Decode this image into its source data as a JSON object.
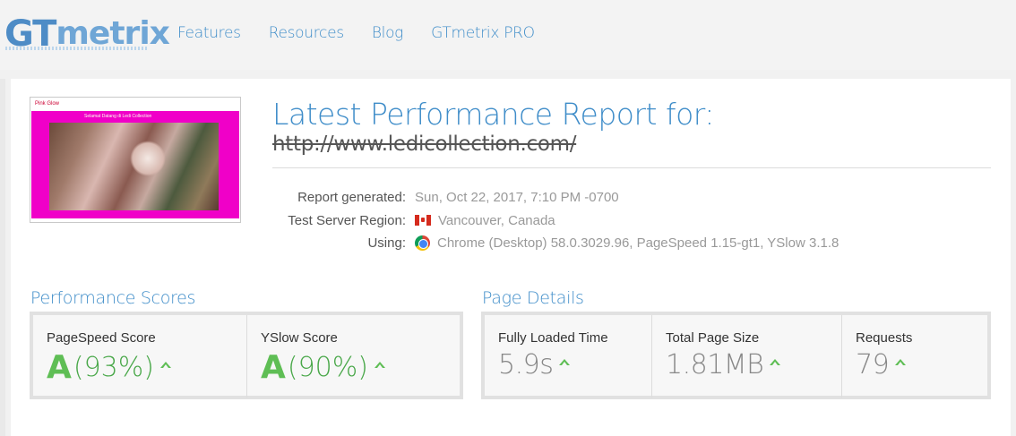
{
  "header": {
    "logo_gt": "GT",
    "logo_metrix": "metrix",
    "nav": [
      "Features",
      "Resources",
      "Blog",
      "GTmetrix PRO"
    ]
  },
  "report": {
    "title": "Latest Performance Report for:",
    "url": "http://www.ledicollection.com/",
    "meta": [
      {
        "label": "Report generated:",
        "value": "Sun, Oct 22, 2017, 7:10 PM -0700",
        "icon": ""
      },
      {
        "label": "Test Server Region:",
        "value": "Vancouver, Canada",
        "icon": "canada-flag-icon"
      },
      {
        "label": "Using:",
        "value": "Chrome (Desktop) 58.0.3029.96, PageSpeed 1.15-gt1, YSlow 3.1.8",
        "icon": "chrome-icon"
      }
    ]
  },
  "thumbnail": {
    "logo_text": "Pink Glow",
    "caption": "Selamat Datang di Ledi Collection"
  },
  "performance": {
    "title": "Performance Scores",
    "scores": [
      {
        "label": "PageSpeed Score",
        "grade": "A",
        "percent": "(93%)"
      },
      {
        "label": "YSlow Score",
        "grade": "A",
        "percent": "(90%)"
      }
    ]
  },
  "details": {
    "title": "Page Details",
    "items": [
      {
        "label": "Fully Loaded Time",
        "value": "5.9s"
      },
      {
        "label": "Total Page Size",
        "value": "1.81MB"
      },
      {
        "label": "Requests",
        "value": "79"
      }
    ]
  },
  "colors": {
    "brand_blue": "#3f8dc9",
    "grade_green": "#5fbe55"
  }
}
